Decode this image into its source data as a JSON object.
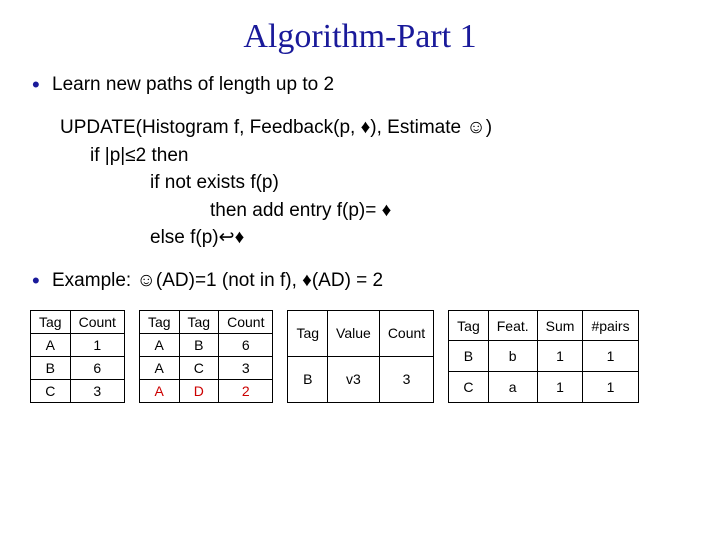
{
  "title": "Algorithm-Part 1",
  "bullets": {
    "b1": "Learn new paths of length up to 2",
    "b2_prefix": "Example: ",
    "b2_mid1": "(AD)=1 (not in f), ",
    "b2_mid2": "(AD) = 2"
  },
  "sym": {
    "est": "☺",
    "s": "♦",
    "le": "≤",
    "up": "↩"
  },
  "algo": {
    "l0a": "UPDATE(Histogram f, Feedback(p, ",
    "l0b": "), Estimate ",
    "l0c": ")",
    "l1a": "if |p|",
    "l1b": "2 then",
    "l2": "if not exists f(p)",
    "l3a": "then add entry f(p)= ",
    "l2b_a": "else f(p)",
    "l2b_b": ""
  },
  "t1": {
    "h": [
      "Tag",
      "Count"
    ],
    "r": [
      [
        "A",
        "1"
      ],
      [
        "B",
        "6"
      ],
      [
        "C",
        "3"
      ]
    ]
  },
  "t2": {
    "h": [
      "Tag",
      "Tag",
      "Count"
    ],
    "r": [
      [
        "A",
        "B",
        "6"
      ],
      [
        "A",
        "C",
        "3"
      ]
    ],
    "new": [
      "A",
      "D",
      "2"
    ]
  },
  "t3": {
    "h": [
      "Tag",
      "Value",
      "Count"
    ],
    "r": [
      [
        "B",
        "v3",
        "3"
      ]
    ]
  },
  "t4": {
    "h": [
      "Tag",
      "Feat.",
      "Sum",
      "#pairs"
    ],
    "r": [
      [
        "B",
        "b",
        "1",
        "1"
      ],
      [
        "C",
        "a",
        "1",
        "1"
      ]
    ]
  }
}
